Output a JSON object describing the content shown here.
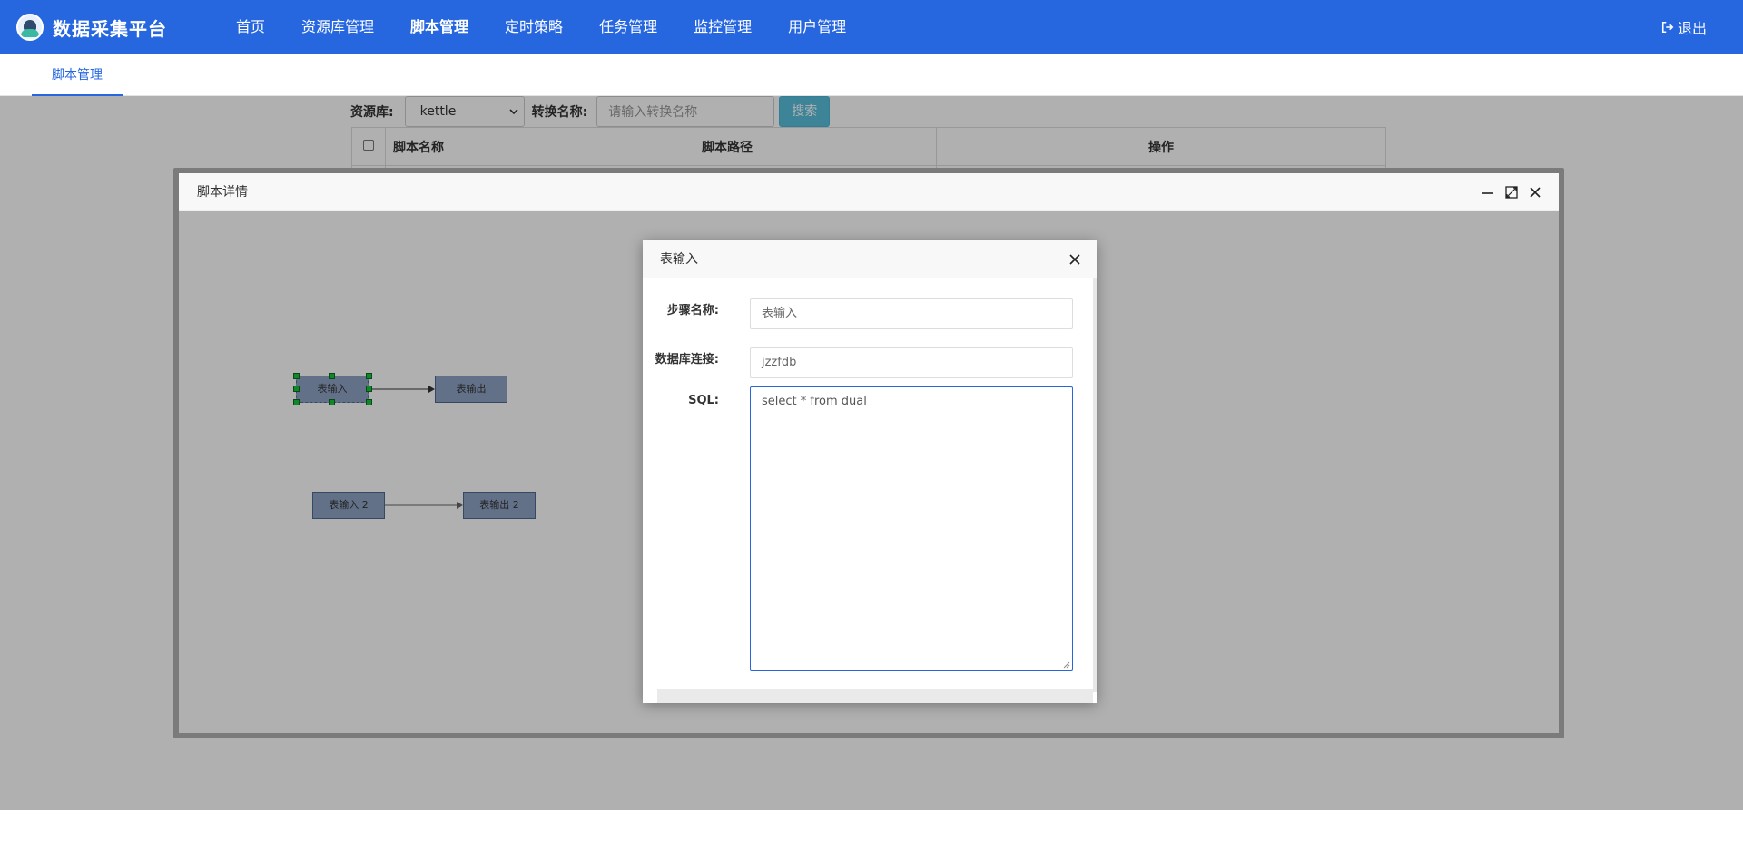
{
  "app": {
    "title": "数据采集平台"
  },
  "nav": {
    "items": [
      {
        "label": "首页"
      },
      {
        "label": "资源库管理"
      },
      {
        "label": "脚本管理"
      },
      {
        "label": "定时策略"
      },
      {
        "label": "任务管理"
      },
      {
        "label": "监控管理"
      },
      {
        "label": "用户管理"
      }
    ],
    "active": "脚本管理",
    "logout_label": "退出"
  },
  "tabs": [
    {
      "label": "脚本管理"
    }
  ],
  "filter": {
    "repo_label": "资源库:",
    "repo_value": "kettle",
    "name_label": "转换名称:",
    "name_placeholder": "请输入转换名称",
    "search_label": "搜索"
  },
  "table": {
    "headers": [
      "脚本名称",
      "脚本路径",
      "操作"
    ]
  },
  "window": {
    "title": "脚本详情",
    "nodes": [
      {
        "label": "表输入"
      },
      {
        "label": "表输出"
      },
      {
        "label": "表输入 2"
      },
      {
        "label": "表输出 2"
      }
    ]
  },
  "dialog": {
    "title": "表输入",
    "fields": {
      "step_name": {
        "label": "步骤名称:",
        "value": "表输入"
      },
      "db_conn": {
        "label": "数据库连接:",
        "value": "jzzfdb"
      },
      "sql": {
        "label": "SQL:",
        "value": "select * from dual"
      }
    }
  },
  "colors": {
    "brand": "#2667e0",
    "search_button": "#5bc0de",
    "node_fill": "#8fa4c5",
    "handle": "#18c43a"
  }
}
